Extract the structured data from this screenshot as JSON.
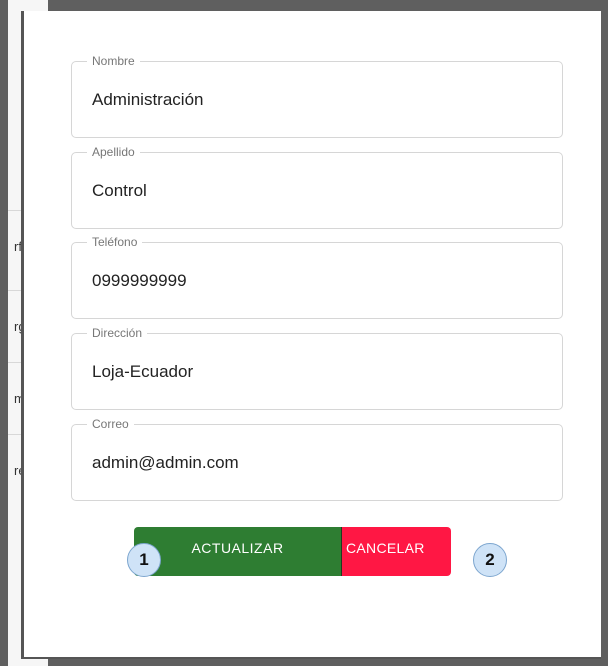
{
  "background": {
    "rows": [
      {
        "text": "rf"
      },
      {
        "text": "rg"
      },
      {
        "text": "m"
      },
      {
        "text": "re"
      }
    ]
  },
  "form": {
    "fields": [
      {
        "label": "Nombre",
        "value": "Administración"
      },
      {
        "label": "Apellido",
        "value": "Control"
      },
      {
        "label": "Teléfono",
        "value": "0999999999"
      },
      {
        "label": "Dirección",
        "value": "Loja-Ecuador"
      },
      {
        "label": "Correo",
        "value": "admin@admin.com"
      }
    ]
  },
  "actions": {
    "update_label": "ACTUALIZAR",
    "cancel_label": "CANCELAR"
  },
  "markers": {
    "first": "1",
    "second": "2"
  },
  "colors": {
    "update_button": "#2e7d32",
    "cancel_button": "#ff1744",
    "marker_fill": "#cfe3f7"
  }
}
